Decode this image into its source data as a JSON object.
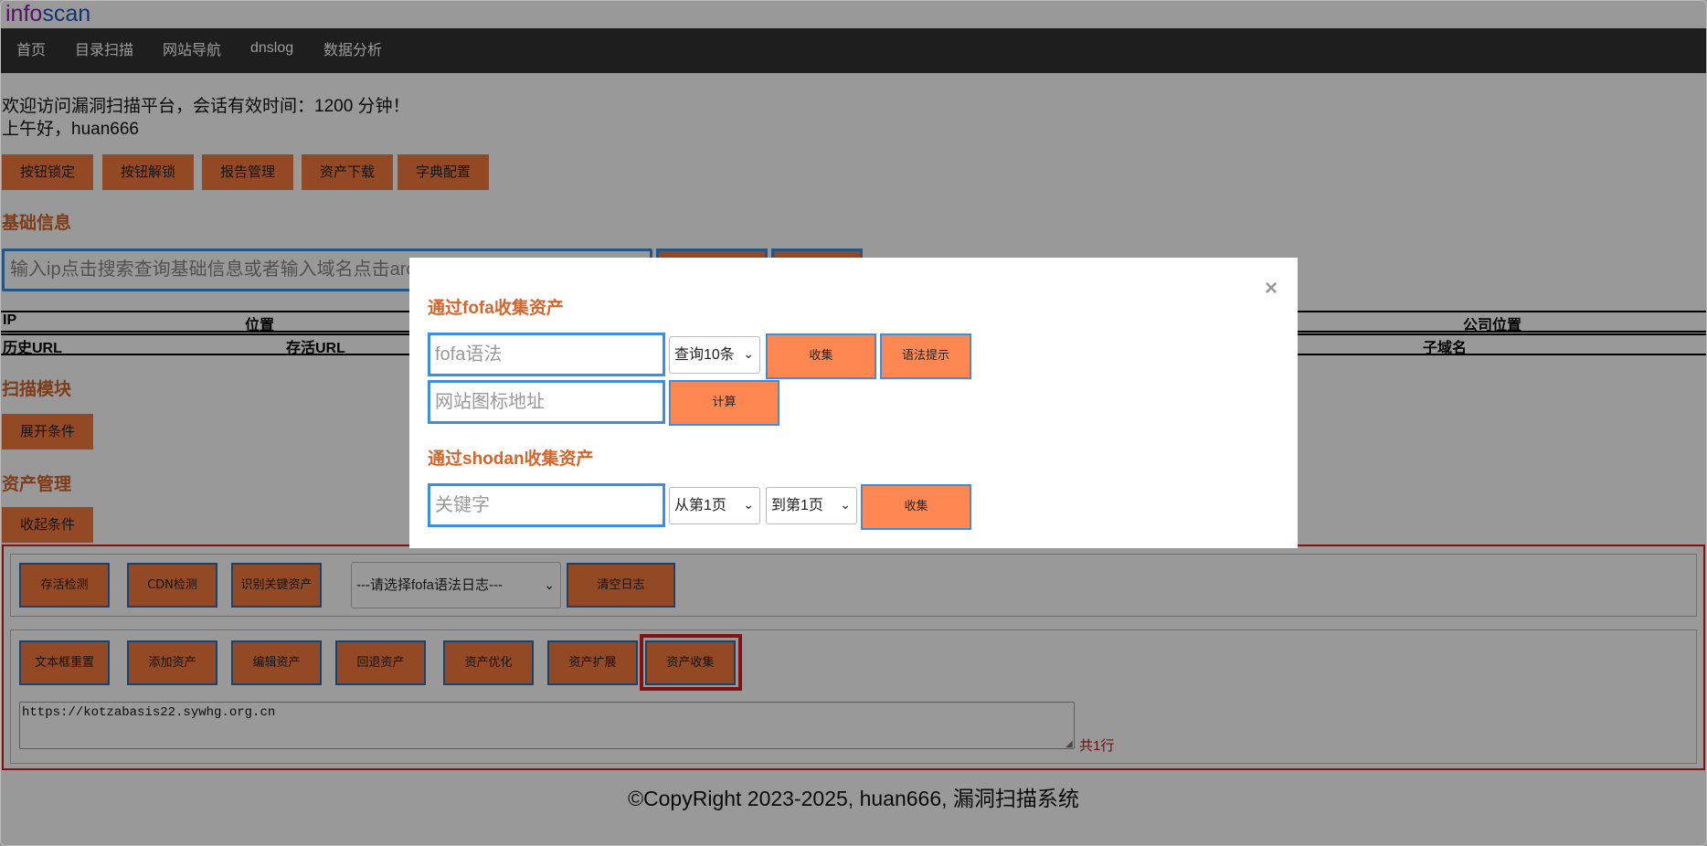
{
  "brand": {
    "part1": "info",
    "part2": "scan"
  },
  "nav": [
    "首页",
    "目录扫描",
    "网站导航",
    "dnslog",
    "数据分析"
  ],
  "welcome": {
    "line1": "欢迎访问漏洞扫描平台，会话有效时间：1200 分钟！",
    "line2": "上午好，huan666"
  },
  "top_buttons": [
    "按钮锁定",
    "按钮解锁",
    "报告管理",
    "资产下载",
    "字典配置"
  ],
  "basic_info": {
    "title": "基础信息",
    "search_placeholder": "输入ip点击搜索查询基础信息或者输入域名点击arc",
    "table1_headers": [
      "IP",
      "位置",
      "公司位置"
    ],
    "table2_headers": [
      "历史URL",
      "存活URL",
      "子域名"
    ]
  },
  "scan_module": {
    "title": "扫描模块",
    "expand_label": "展开条件"
  },
  "asset_mgmt": {
    "title": "资产管理",
    "collapse_label": "收起条件",
    "row1_buttons": [
      "存活检测",
      "CDN检测",
      "识别关键资产"
    ],
    "log_select": "---请选择fofa语法日志---",
    "clear_log": "清空日志",
    "row2_buttons": [
      "文本框重置",
      "添加资产",
      "编辑资产",
      "回退资产",
      "资产优化",
      "资产扩展",
      "资产收集"
    ],
    "textarea_value": "https://kotzabasis22.sywhg.org.cn",
    "row_count": "共1行"
  },
  "footer": "©CopyRight 2023-2025, huan666, 漏洞扫描系统",
  "modal": {
    "close": "×",
    "fofa_title": "通过fofa收集资产",
    "fofa_placeholder": "fofa语法",
    "fofa_count": "查询10条",
    "collect": "收集",
    "syntax_hint": "语法提示",
    "icon_placeholder": "网站图标地址",
    "calc": "计算",
    "shodan_title": "通过shodan收集资产",
    "keyword_placeholder": "关键字",
    "from_page": "从第1页",
    "to_page": "到第1页",
    "shodan_collect": "收集"
  },
  "colors": {
    "accent": "#f47a3c",
    "title": "#d4652b",
    "nav_bg": "#333333",
    "highlight": "#d9211f"
  }
}
